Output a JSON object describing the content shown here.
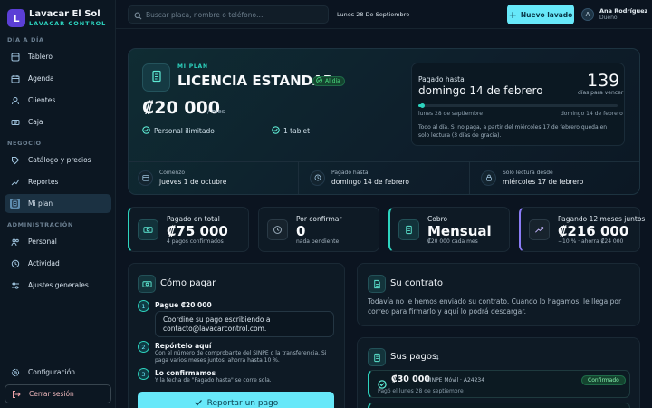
{
  "brand": {
    "name": "Lavacar El Sol",
    "subtitle": "LAVACAR CONTROL",
    "logo_letter": "L",
    "accent": "#2dd4bf",
    "logo_color": "#5b3fd6"
  },
  "sidebar": {
    "sections": [
      "DÍA A DÍA",
      "NEGOCIO",
      "ADMINISTRACIÓN"
    ],
    "items": [
      {
        "label": "Tablero",
        "icon": "dashboard-icon"
      },
      {
        "label": "Agenda",
        "icon": "calendar-icon"
      },
      {
        "label": "Clientes",
        "icon": "users-icon"
      },
      {
        "label": "Caja",
        "icon": "cash-icon"
      },
      {
        "label": "Catálogo y precios",
        "icon": "tag-icon"
      },
      {
        "label": "Reportes",
        "icon": "chart-icon"
      },
      {
        "label": "Mi plan",
        "icon": "receipt-icon",
        "active": true
      },
      {
        "label": "Personal",
        "icon": "people-icon"
      },
      {
        "label": "Actividad",
        "icon": "history-icon"
      },
      {
        "label": "Ajustes generales",
        "icon": "sliders-icon"
      }
    ],
    "settings_label": "Configuración",
    "logout_label": "Cerrar sesión"
  },
  "topbar": {
    "search_placeholder": "Buscar placa, nombre o teléfono…",
    "date": "Lunes 28 De Septiembre",
    "new_button": "Nuevo lavado",
    "user_initial": "A",
    "user_name": "Ana Rodríguez",
    "user_role": "Dueño"
  },
  "plan": {
    "kicker": "MI PLAN",
    "name": "LICENCIA ESTANDAR",
    "status": "Al día",
    "price": "₡20 000",
    "period": "/ mes",
    "features": [
      "Personal ilimitado",
      "1 tablet"
    ],
    "paid_until_label": "Pagado hasta",
    "paid_until": "domingo 14 de febrero",
    "days_left": "139",
    "days_left_label": "días para vencer",
    "progress": 0.02,
    "range_start": "lunes 28 de septiembre",
    "range_end": "domingo 14 de febrero",
    "note": "Todo al día. Si no paga, a partir del miércoles 17 de febrero queda en solo lectura (3 días de gracia).",
    "strip": [
      {
        "key": "Comenzó",
        "value": "jueves 1 de octubre",
        "icon": "calendar-icon"
      },
      {
        "key": "Pagado hasta",
        "value": "domingo 14 de febrero",
        "icon": "clock-icon"
      },
      {
        "key": "Solo lectura desde",
        "value": "miércoles 17 de febrero",
        "icon": "lock-icon"
      }
    ]
  },
  "stats": [
    {
      "label": "Pagado en total",
      "value": "₡75 000",
      "sub": "4 pagos confirmados",
      "icon": "banknote-icon"
    },
    {
      "label": "Por confirmar",
      "value": "0",
      "sub": "nada pendiente",
      "icon": "clock-icon"
    },
    {
      "label": "Cobro",
      "value": "Mensual",
      "sub": "₡20 000 cada mes",
      "icon": "receipt-icon"
    },
    {
      "label": "Pagando 12 meses juntos",
      "value": "₡216 000",
      "sub": "−10 % · ahorra ₡24 000",
      "icon": "trend-up-icon"
    }
  ],
  "how_to_pay": {
    "title": "Cómo pagar",
    "steps": [
      {
        "n": "1",
        "title": "Pague ₡20 000",
        "text": ""
      },
      {
        "n": "2",
        "title": "Repórtelo aquí",
        "text": "Con el número de comprobante del SINPE o la transferencia. Si paga varios meses juntos, ahorra hasta 10 %."
      },
      {
        "n": "3",
        "title": "Lo confirmamos",
        "text": "Y la fecha de \"Pagado hasta\" se corre sola."
      }
    ],
    "contact_text": "Coordine su pago escribiendo a contacto@lavacarcontrol.com.",
    "button": "Reportar un pago"
  },
  "contract": {
    "title": "Su contrato",
    "text": "Todavía no le hemos enviado su contrato. Cuando lo hagamos, le llega por correo para firmarlo y aquí lo podrá descargar."
  },
  "payments": {
    "title": "Sus pagos",
    "count": "4",
    "items": [
      {
        "amount": "₡30 000",
        "ref": "SINPE Móvil · A24234",
        "date": "Pagó el lunes 28 de septiembre",
        "status": "Confirmado"
      }
    ]
  }
}
